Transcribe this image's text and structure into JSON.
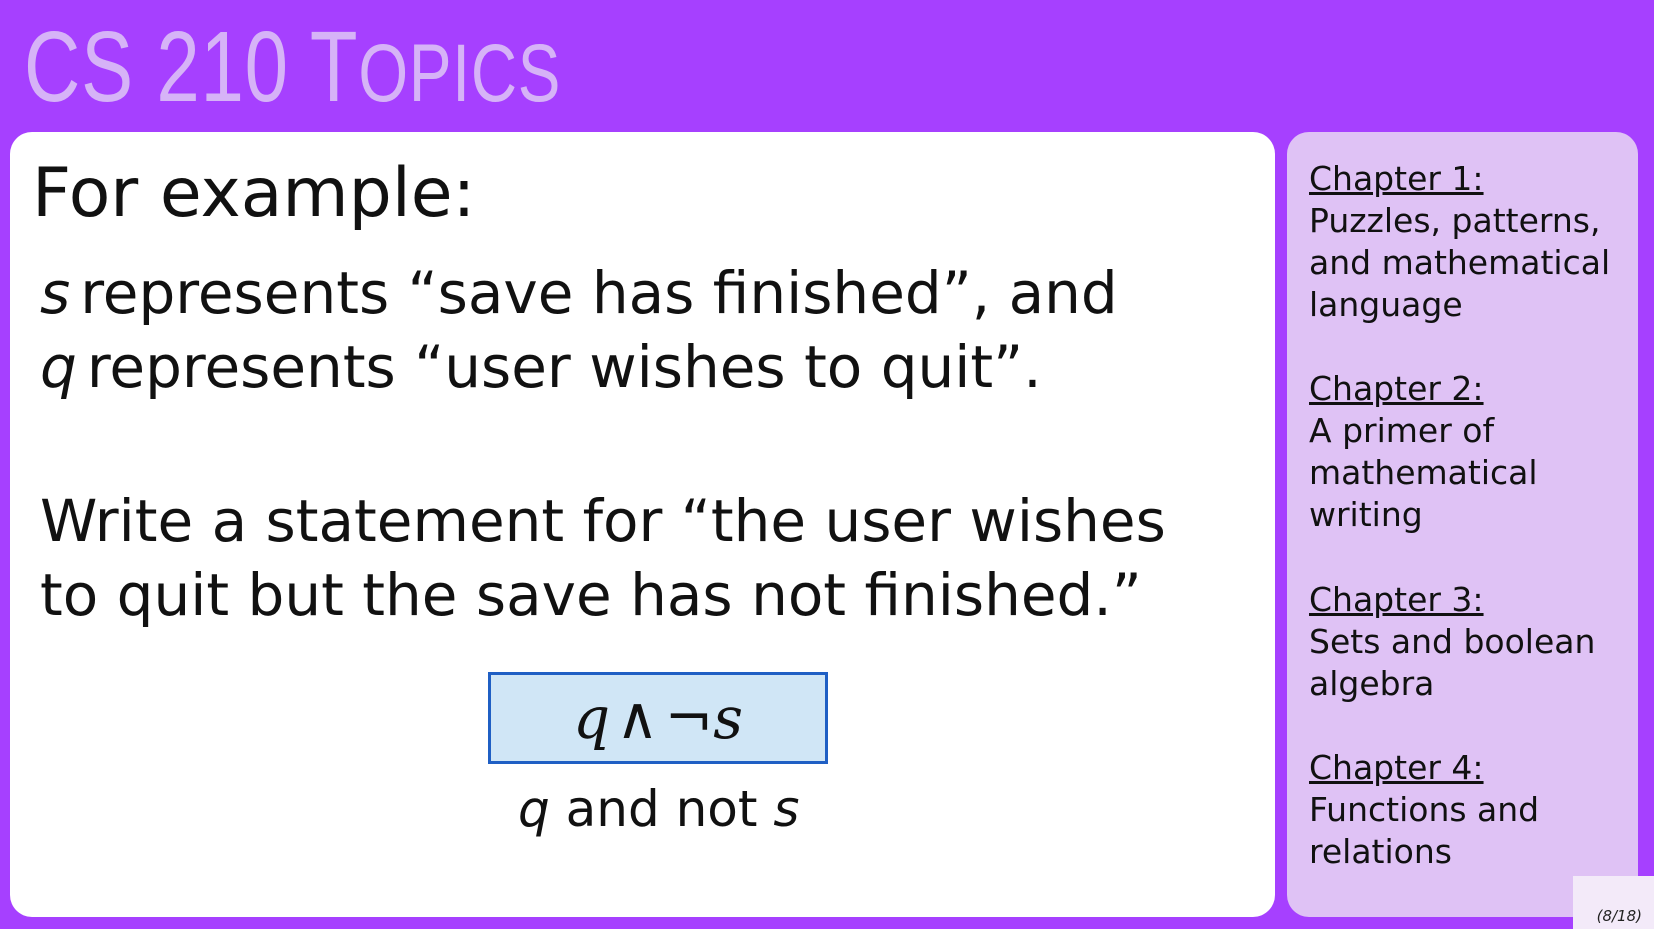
{
  "slide": {
    "title_main": "CS 210 T",
    "title_rest": "OPICS",
    "page_number": "(8/18)"
  },
  "main": {
    "heading": "For example:",
    "definitions": [
      {
        "var": "s",
        "text": "represents “save has finished”, and"
      },
      {
        "var": "q",
        "text": "represents “user wishes to quit”."
      }
    ],
    "prompt_lines": [
      "Write a statement for “the user wishes",
      "to quit but the save has not finished.”"
    ],
    "answer": {
      "var_left": "q",
      "and_symbol": "∧",
      "not_symbol": "¬",
      "var_right": "s"
    },
    "caption": {
      "var_left": "q",
      "middle": " and not ",
      "var_right": "s"
    }
  },
  "sidebar": {
    "chapters": [
      {
        "label": "Chapter 1:",
        "name": "Puzzles, patterns, and mathematical language"
      },
      {
        "label": "Chapter 2:",
        "name": "A primer of mathematical writing"
      },
      {
        "label": "Chapter 3:",
        "name": "Sets and boolean algebra"
      },
      {
        "label": "Chapter 4:",
        "name": "Functions and relations"
      }
    ]
  }
}
